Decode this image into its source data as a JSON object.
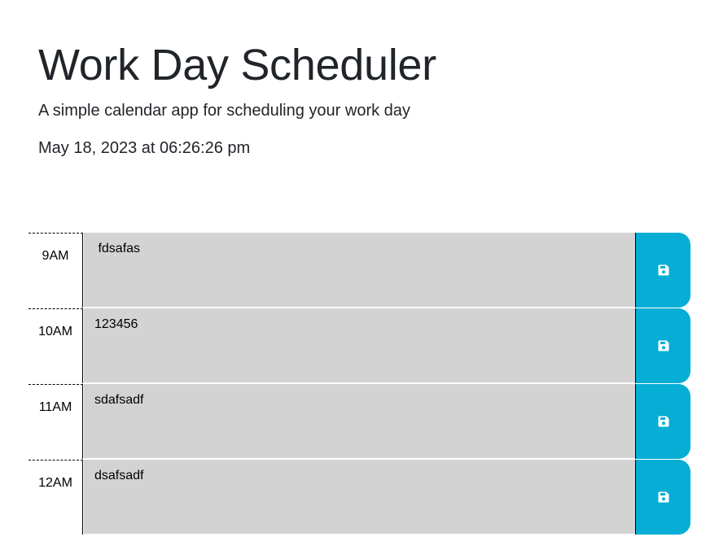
{
  "header": {
    "title": "Work Day Scheduler",
    "subtitle": "A simple calendar app for scheduling your work day",
    "current_datetime": "May 18, 2023 at 06:26:26 pm"
  },
  "schedule": {
    "rows": [
      {
        "hour": "9AM",
        "text": " fdsafas"
      },
      {
        "hour": "10AM",
        "text": "123456"
      },
      {
        "hour": "11AM",
        "text": "sdafsadf"
      },
      {
        "hour": "12AM",
        "text": "dsafsadf"
      }
    ],
    "save_icon": "floppy-disk-icon"
  },
  "colors": {
    "past_block": "#d3d3d3",
    "save_button": "#06aed5",
    "save_icon": "#ffffff"
  }
}
